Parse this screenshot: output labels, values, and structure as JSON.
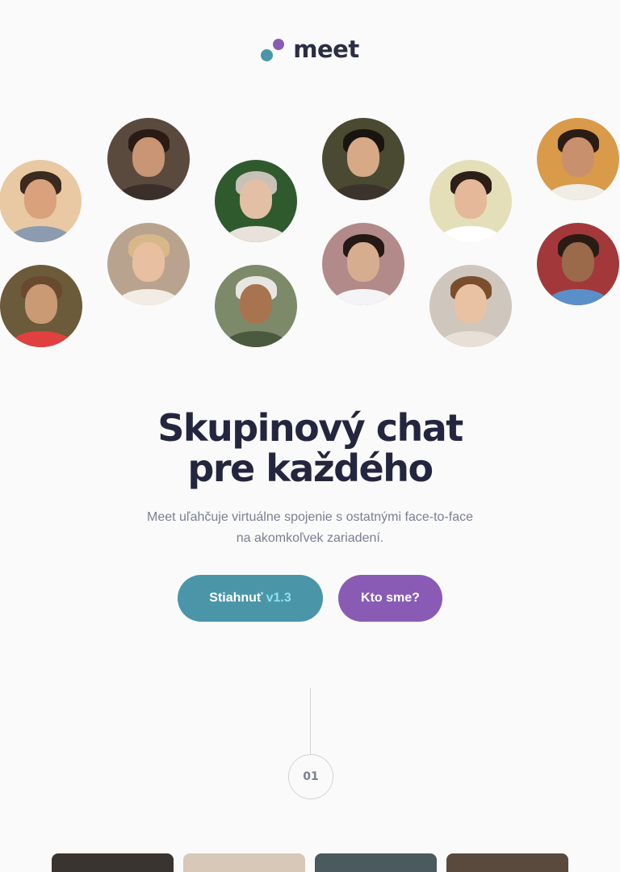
{
  "brand": {
    "name": "meet",
    "colors": {
      "teal": "#4a96a8",
      "purple": "#8a5bb5",
      "dark": "#24263f"
    }
  },
  "avatars": [
    {
      "icon": "person-photo",
      "bg": "#e9c9a3",
      "skin": "#d9a27c",
      "hair": "#3b2a1e",
      "shirt": "#8c9bb0"
    },
    {
      "icon": "person-photo",
      "bg": "#5a4a3e",
      "skin": "#c99575",
      "hair": "#2a1c15",
      "shirt": "#3a2f2a"
    },
    {
      "icon": "person-photo",
      "bg": "#2f5a2e",
      "skin": "#e2bfa5",
      "hair": "#c7c1b8",
      "shirt": "#e8e2da"
    },
    {
      "icon": "person-photo",
      "bg": "#4a4a32",
      "skin": "#d7a987",
      "hair": "#1a1410",
      "shirt": "#3b332c"
    },
    {
      "icon": "person-photo",
      "bg": "#e4dfb8",
      "skin": "#e6b89a",
      "hair": "#2c1f17",
      "shirt": "#ffffff"
    },
    {
      "icon": "person-photo",
      "bg": "#d99a4a",
      "skin": "#c9906d",
      "hair": "#2b1d14",
      "shirt": "#f0ede6"
    },
    {
      "icon": "person-photo",
      "bg": "#6b5b3a",
      "skin": "#c99a74",
      "hair": "#6a4a2e",
      "shirt": "#e04040"
    },
    {
      "icon": "person-photo",
      "bg": "#b8a48e",
      "skin": "#e8bfa0",
      "hair": "#d8b888",
      "shirt": "#f2ece4"
    },
    {
      "icon": "person-photo",
      "bg": "#7c8a6a",
      "skin": "#a8744f",
      "hair": "#e8e6e2",
      "shirt": "#4a5a3e"
    },
    {
      "icon": "person-photo",
      "bg": "#b28a8a",
      "skin": "#d6ad8e",
      "hair": "#241914",
      "shirt": "#f4f4f6"
    },
    {
      "icon": "person-photo",
      "bg": "#cfc6bd",
      "skin": "#e9c2a4",
      "hair": "#7a4e2c",
      "shirt": "#e8e0d6"
    },
    {
      "icon": "person-photo",
      "bg": "#a3383a",
      "skin": "#9a6a4a",
      "hair": "#2a1c15",
      "shirt": "#5b8fc9"
    }
  ],
  "hero": {
    "title_line1": "Skupinový chat",
    "title_line2": "pre každého",
    "subtitle_line1": "Meet uľahčuje virtuálne spojenie s ostatnými face-to-face",
    "subtitle_line2": "na akomkoľvek zariadení."
  },
  "actions": {
    "download_label": "Stiahnuť",
    "download_version": "v1.3",
    "about_label": "Kto sme?"
  },
  "step": {
    "number": "01"
  },
  "cards": [
    {
      "icon": "photo-thumbnail",
      "bg": "#3a3430"
    },
    {
      "icon": "photo-thumbnail",
      "bg": "#d8c8b8"
    },
    {
      "icon": "photo-thumbnail",
      "bg": "#4a5a5e"
    },
    {
      "icon": "photo-thumbnail",
      "bg": "#5a4a3e"
    }
  ]
}
